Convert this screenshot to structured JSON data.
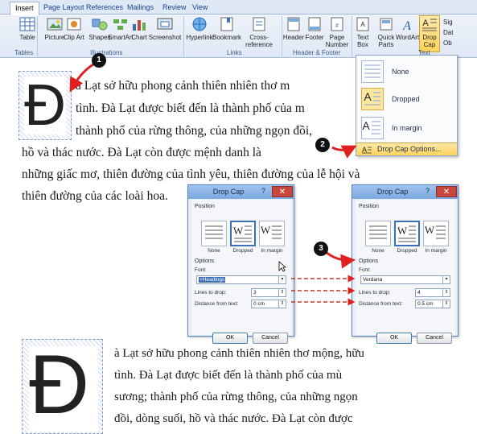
{
  "ribbon": {
    "tabs": [
      "Insert",
      "Page Layout",
      "References",
      "Mailings",
      "Review",
      "View"
    ],
    "active_tab": "Insert",
    "table_label": "Table",
    "picture_label": "Picture",
    "clipart_label": "Clip Art",
    "shapes_label": "Shapes",
    "smartart_label": "SmartArt",
    "chart_label": "Chart",
    "screenshot_label": "Screenshot",
    "hyperlink_label": "Hyperlink",
    "bookmark_label": "Bookmark",
    "crossref_label": "Cross-reference",
    "header_label": "Header",
    "footer_label": "Footer",
    "pagenumber_label": "Page Number",
    "textbox_label": "Text Box",
    "quickparts_label": "Quick Parts",
    "wordart_label": "WordArt",
    "dropcap_label": "Drop Cap",
    "groups": {
      "tables": "Tables",
      "illustrations": "Illustrations",
      "links": "Links",
      "header_footer": "Header & Footer",
      "text": "Text"
    },
    "side_items": [
      "Sig",
      "Dat",
      "Ob"
    ]
  },
  "dropcap_menu": {
    "items": [
      "None",
      "Dropped",
      "In margin"
    ],
    "options_label": "Drop Cap Options..."
  },
  "document_top": {
    "dropcap_letter": "Đ",
    "lines": [
      "à Lạt sở hữu phong cảnh thiên nhiên thơ m",
      "tình. Đà Lạt được biết đến là thành phố của m",
      "thành phố của rừng thông, của những ngọn đồi,",
      "hồ và thác nước. Đà Lạt còn được mệnh danh là",
      "những giấc mơ, thiên đường của tình yêu, thiên đường của lễ hội và",
      "thiên đường của các loài hoa."
    ]
  },
  "dialog_before": {
    "title": "Drop Cap",
    "help": "?",
    "close": "✕",
    "position_label": "Position",
    "positions": [
      "None",
      "Dropped",
      "In margin"
    ],
    "options_label": "Options",
    "font_label": "Font:",
    "font_value": "+Headings",
    "lines_label": "Lines to drop:",
    "lines_value": "3",
    "distance_label": "Distance from text:",
    "distance_value": "0 cm",
    "ok": "OK",
    "cancel": "Cancel"
  },
  "dialog_after": {
    "title": "Drop Cap",
    "help": "?",
    "close": "✕",
    "position_label": "Position",
    "positions": [
      "None",
      "Dropped",
      "In margin"
    ],
    "options_label": "Options",
    "font_label": "Font:",
    "font_value": "Verdana",
    "lines_label": "Lines to drop:",
    "lines_value": "4",
    "distance_label": "Distance from text:",
    "distance_value": "0.5 cm",
    "ok": "OK",
    "cancel": "Cancel"
  },
  "document_bottom": {
    "dropcap_letter": "Đ",
    "lines": [
      "à Lạt sở hữu phong cảnh thiên nhiên thơ mộng, hữu",
      "tình. Đà Lạt được biết đến là thành phố của mù",
      "sương; thành phố của rừng thông, của những ngọn",
      "đồi, dòng suối, hồ và thác nước. Đà Lạt còn được"
    ]
  },
  "callouts": [
    "1",
    "2",
    "3"
  ],
  "colors": {
    "arrow": "#e02020",
    "accent": "#3b6fb6",
    "highlight": "#ffd35b"
  }
}
